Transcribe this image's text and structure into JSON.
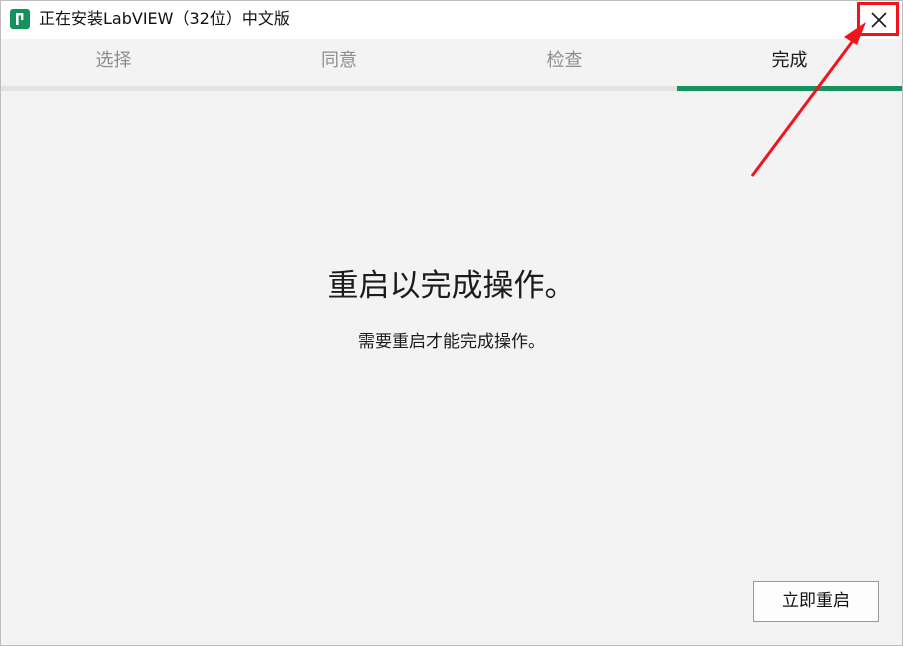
{
  "window": {
    "title": "正在安装LabVIEW（32位）中文版",
    "app_icon": "labview-installer-icon",
    "close_icon": "close-icon"
  },
  "tabs": [
    {
      "label": "选择",
      "active": false
    },
    {
      "label": "同意",
      "active": false
    },
    {
      "label": "检查",
      "active": false
    },
    {
      "label": "完成",
      "active": true
    }
  ],
  "main": {
    "heading": "重启以完成操作。",
    "subtext": "需要重启才能完成操作。"
  },
  "buttons": {
    "restart_now": "立即重启"
  },
  "colors": {
    "accent": "#16915f",
    "annotation": "#f0141e",
    "inactive_tab_text": "#8e8e8e",
    "background": "#f3f3f3"
  }
}
